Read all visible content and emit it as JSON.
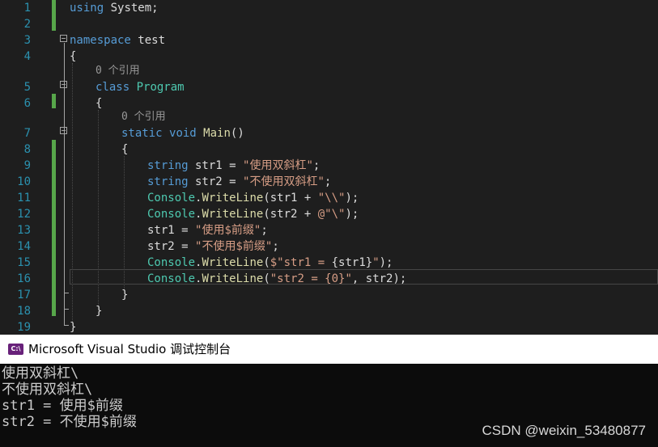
{
  "editor": {
    "lines": [
      {
        "n": "1",
        "tokens": [
          {
            "t": "using",
            "c": "kw"
          },
          {
            "t": " System;",
            "c": "pl"
          }
        ]
      },
      {
        "n": "2",
        "tokens": []
      },
      {
        "n": "3",
        "tokens": [
          {
            "t": "namespace",
            "c": "kw"
          },
          {
            "t": " test",
            "c": "pl"
          }
        ]
      },
      {
        "n": "4",
        "tokens": [
          {
            "t": "{",
            "c": "pl"
          }
        ]
      },
      {
        "n": "5",
        "tokens": [
          {
            "t": "class",
            "c": "kw"
          },
          {
            "t": " ",
            "c": "pl"
          },
          {
            "t": "Program",
            "c": "ty"
          }
        ]
      },
      {
        "n": "6",
        "tokens": [
          {
            "t": "{",
            "c": "pl"
          }
        ]
      },
      {
        "n": "7",
        "tokens": [
          {
            "t": "static",
            "c": "kw"
          },
          {
            "t": " ",
            "c": "pl"
          },
          {
            "t": "void",
            "c": "kw"
          },
          {
            "t": " ",
            "c": "pl"
          },
          {
            "t": "Main",
            "c": "fn"
          },
          {
            "t": "()",
            "c": "pl"
          }
        ]
      },
      {
        "n": "8",
        "tokens": [
          {
            "t": "{",
            "c": "pl"
          }
        ]
      },
      {
        "n": "9",
        "tokens": [
          {
            "t": "string",
            "c": "kw"
          },
          {
            "t": " str1 = ",
            "c": "pl"
          },
          {
            "t": "\"使用双斜杠\"",
            "c": "str"
          },
          {
            "t": ";",
            "c": "pl"
          }
        ]
      },
      {
        "n": "10",
        "tokens": [
          {
            "t": "string",
            "c": "kw"
          },
          {
            "t": " str2 = ",
            "c": "pl"
          },
          {
            "t": "\"不使用双斜杠\"",
            "c": "str"
          },
          {
            "t": ";",
            "c": "pl"
          }
        ]
      },
      {
        "n": "11",
        "tokens": [
          {
            "t": "Console",
            "c": "ty"
          },
          {
            "t": ".",
            "c": "pl"
          },
          {
            "t": "WriteLine",
            "c": "fn"
          },
          {
            "t": "(str1 + ",
            "c": "pl"
          },
          {
            "t": "\"\\\\\"",
            "c": "str"
          },
          {
            "t": ");",
            "c": "pl"
          }
        ]
      },
      {
        "n": "12",
        "tokens": [
          {
            "t": "Console",
            "c": "ty"
          },
          {
            "t": ".",
            "c": "pl"
          },
          {
            "t": "WriteLine",
            "c": "fn"
          },
          {
            "t": "(str2 + ",
            "c": "pl"
          },
          {
            "t": "@\"\\\"",
            "c": "str"
          },
          {
            "t": ");",
            "c": "pl"
          }
        ]
      },
      {
        "n": "13",
        "tokens": [
          {
            "t": "str1 = ",
            "c": "pl"
          },
          {
            "t": "\"使用$前缀\"",
            "c": "str"
          },
          {
            "t": ";",
            "c": "pl"
          }
        ]
      },
      {
        "n": "14",
        "tokens": [
          {
            "t": "str2 = ",
            "c": "pl"
          },
          {
            "t": "\"不使用$前缀\"",
            "c": "str"
          },
          {
            "t": ";",
            "c": "pl"
          }
        ]
      },
      {
        "n": "15",
        "tokens": [
          {
            "t": "Console",
            "c": "ty"
          },
          {
            "t": ".",
            "c": "pl"
          },
          {
            "t": "WriteLine",
            "c": "fn"
          },
          {
            "t": "(",
            "c": "pl"
          },
          {
            "t": "$\"str1 = ",
            "c": "str"
          },
          {
            "t": "{str1}",
            "c": "pl"
          },
          {
            "t": "\"",
            "c": "str"
          },
          {
            "t": ");",
            "c": "pl"
          }
        ]
      },
      {
        "n": "16",
        "tokens": [
          {
            "t": "Console",
            "c": "ty"
          },
          {
            "t": ".",
            "c": "pl"
          },
          {
            "t": "WriteLine",
            "c": "fn"
          },
          {
            "t": "(",
            "c": "pl"
          },
          {
            "t": "\"str2 = {0}\"",
            "c": "str"
          },
          {
            "t": ", str2);",
            "c": "pl"
          }
        ]
      },
      {
        "n": "17",
        "tokens": [
          {
            "t": "}",
            "c": "pl"
          }
        ]
      },
      {
        "n": "18",
        "tokens": [
          {
            "t": "}",
            "c": "pl"
          }
        ]
      },
      {
        "n": "19",
        "tokens": [
          {
            "t": "}",
            "c": "pl"
          }
        ]
      }
    ],
    "codelens": [
      "0 个引用",
      "0 个引用"
    ]
  },
  "console": {
    "title": "Microsoft Visual Studio 调试控制台",
    "icon_text": "C:\\",
    "output": [
      "使用双斜杠\\",
      "不使用双斜杠\\",
      "str1 = 使用$前缀",
      "str2 = 不使用$前缀"
    ]
  },
  "watermark": "CSDN @weixin_53480877",
  "colors": {
    "keyword": "#569cd6",
    "type": "#4ec9b0",
    "method": "#dcdcaa",
    "string": "#d69d85",
    "plain": "#dcdcdc",
    "line_number": "#2b91af",
    "change_bar": "#57a64a",
    "console_icon": "#68217a"
  }
}
